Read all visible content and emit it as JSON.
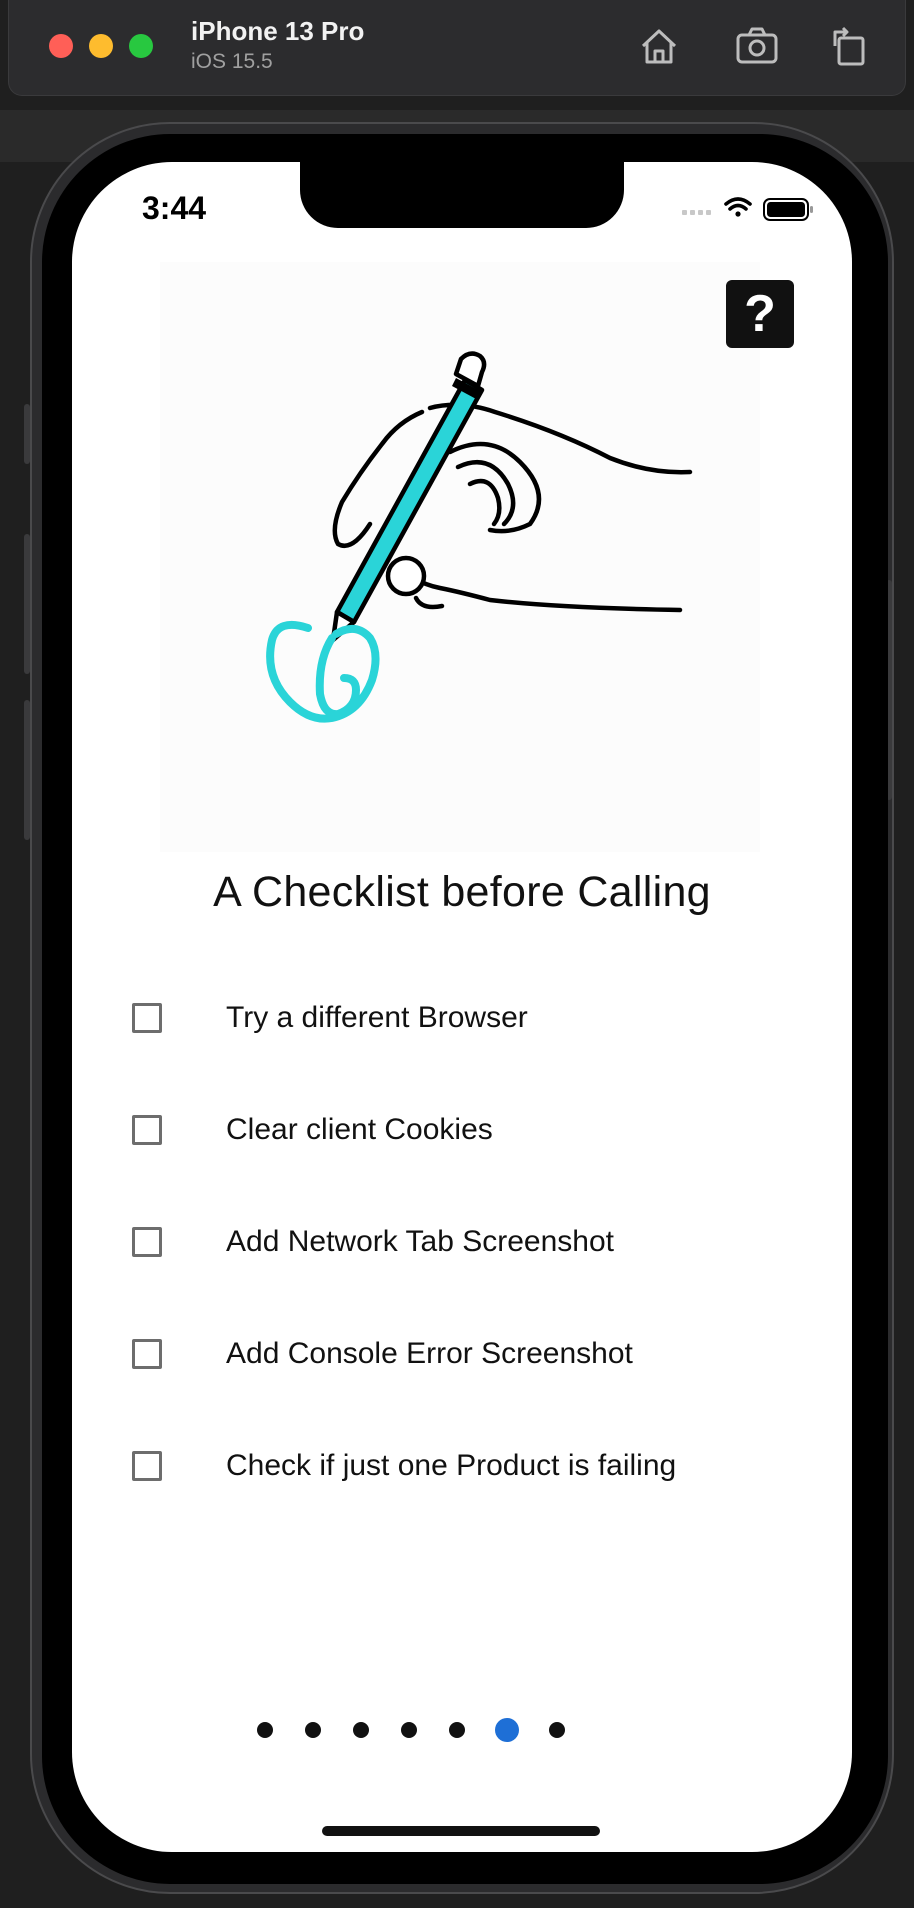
{
  "simulator": {
    "device_name": "iPhone 13 Pro",
    "os_version": "iOS 15.5",
    "toolbar_icons": [
      "home-icon",
      "screenshot-icon",
      "rotate-icon"
    ]
  },
  "status_bar": {
    "time": "3:44",
    "icons": [
      "signal-icon",
      "wifi-icon",
      "battery-icon"
    ]
  },
  "help_button": {
    "label": "?"
  },
  "page": {
    "title": "A Checklist before Calling",
    "checklist": [
      {
        "label": "Try a different Browser",
        "checked": false
      },
      {
        "label": "Clear client Cookies",
        "checked": false
      },
      {
        "label": "Add Network Tab Screenshot",
        "checked": false
      },
      {
        "label": "Add Console Error Screenshot",
        "checked": false
      },
      {
        "label": "Check if just one Product is failing",
        "checked": false
      }
    ]
  },
  "pager": {
    "count": 7,
    "active_index": 5
  },
  "colors": {
    "accent": "#1e6fd6",
    "illustration_accent": "#2ad4d8"
  }
}
